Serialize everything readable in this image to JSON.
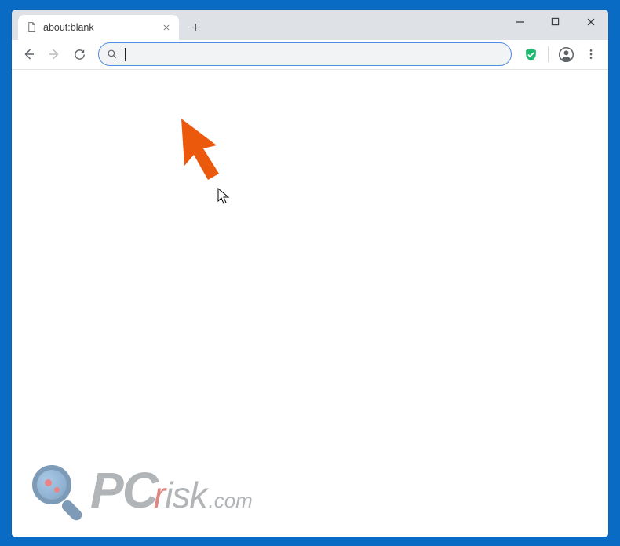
{
  "tab": {
    "title": "about:blank",
    "favicon": "page-icon"
  },
  "omnibox": {
    "value": "",
    "placeholder": ""
  },
  "watermark": {
    "pc": "PC",
    "risk_rest": "isk",
    "com": ".com"
  },
  "colors": {
    "accent_arrow": "#eb5a0c",
    "window_frame": "#0a6bc5",
    "shield": "#1fb971"
  }
}
